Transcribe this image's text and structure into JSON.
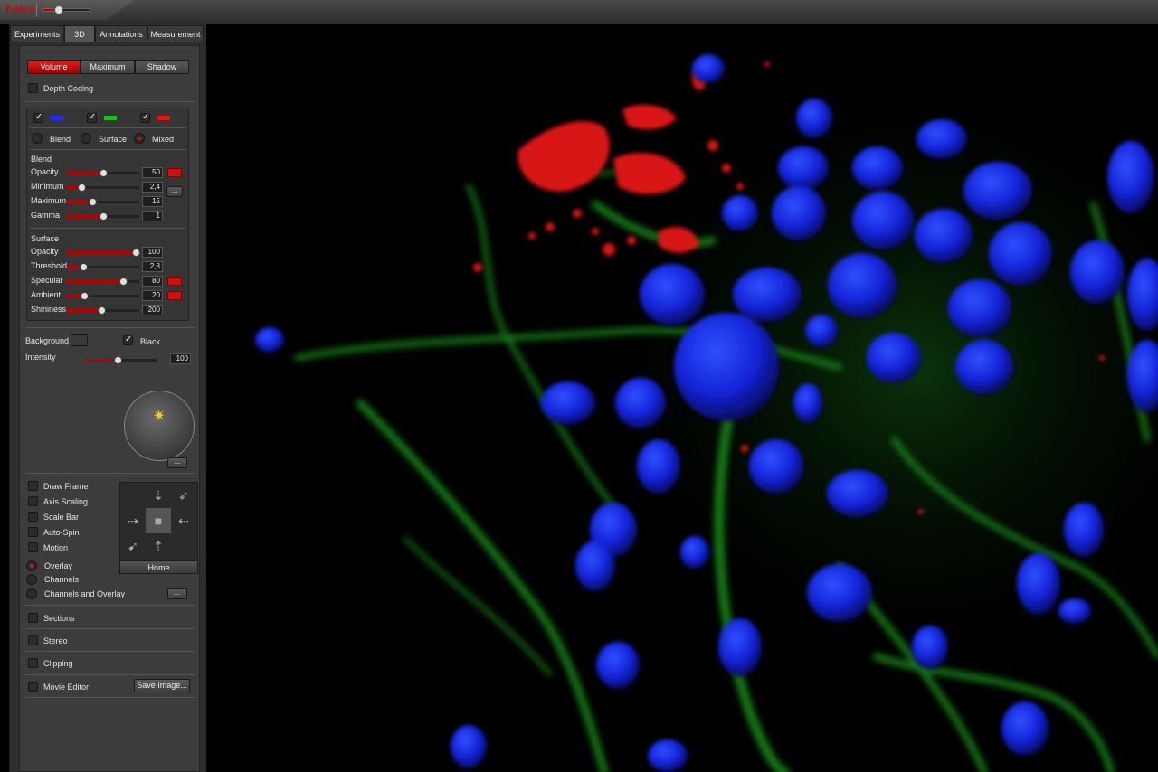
{
  "app": {
    "logo": "Leica",
    "zoom_fraction": 0.35
  },
  "tabs": [
    "Experiments",
    "3D",
    "Annotations",
    "Measurement"
  ],
  "active_tab": "3D",
  "render_modes": [
    "Volume",
    "Maximum",
    "Shadow"
  ],
  "active_render_mode": "Volume",
  "depth_coding": {
    "label": "Depth Coding",
    "checked": false
  },
  "channels": [
    {
      "checked": true,
      "color": "#1a2cff"
    },
    {
      "checked": true,
      "color": "#18c018"
    },
    {
      "checked": true,
      "color": "#ee1010"
    }
  ],
  "mode_options": {
    "blend": "Blend",
    "surface": "Surface",
    "mixed": "Mixed",
    "selected": "Mixed"
  },
  "blend": {
    "title": "Blend",
    "rows": [
      {
        "label": "Opacity",
        "value": "50",
        "level": 0.5
      },
      {
        "label": "Minimum",
        "value": "2,4",
        "level": 0.2
      },
      {
        "label": "Maximum",
        "value": "15",
        "level": 0.35
      },
      {
        "label": "Gamma",
        "value": "1",
        "level": 0.5
      }
    ]
  },
  "surface": {
    "title": "Surface",
    "rows": [
      {
        "label": "Opacity",
        "value": "100",
        "level": 0.95
      },
      {
        "label": "Threshold",
        "value": "2,8",
        "level": 0.22
      },
      {
        "label": "Specular",
        "value": "80",
        "level": 0.78
      },
      {
        "label": "Ambient",
        "value": "20",
        "level": 0.24
      },
      {
        "label": "Shininess",
        "value": "200",
        "level": 0.48
      }
    ]
  },
  "background": {
    "label": "Background",
    "black_label": "Black",
    "black_checked": true
  },
  "intensity": {
    "label": "Intensity",
    "value": "100",
    "level": 0.45
  },
  "more_label": "...",
  "options": [
    {
      "label": "Draw Frame",
      "checked": false
    },
    {
      "label": "Axis Scaling",
      "checked": false
    },
    {
      "label": "Scale Bar",
      "checked": false
    },
    {
      "label": "Auto-Spin",
      "checked": false
    },
    {
      "label": "Motion",
      "checked": false
    }
  ],
  "overlay_options": [
    {
      "label": "Overlay",
      "selected": true
    },
    {
      "label": "Channels",
      "selected": false
    },
    {
      "label": "Channels and Overlay",
      "selected": false
    }
  ],
  "home_label": "Home",
  "sections": [
    {
      "label": "Sections",
      "checked": false
    },
    {
      "label": "Stereo",
      "checked": false
    },
    {
      "label": "Clipping",
      "checked": false
    },
    {
      "label": "Movie Editor",
      "checked": false
    }
  ],
  "save_image_label": "Save Image...",
  "colors": {
    "accent": "#d01010",
    "panel": "#3c3c3c",
    "blue": "#1a2cff",
    "green": "#18c018",
    "red": "#ee1010"
  }
}
